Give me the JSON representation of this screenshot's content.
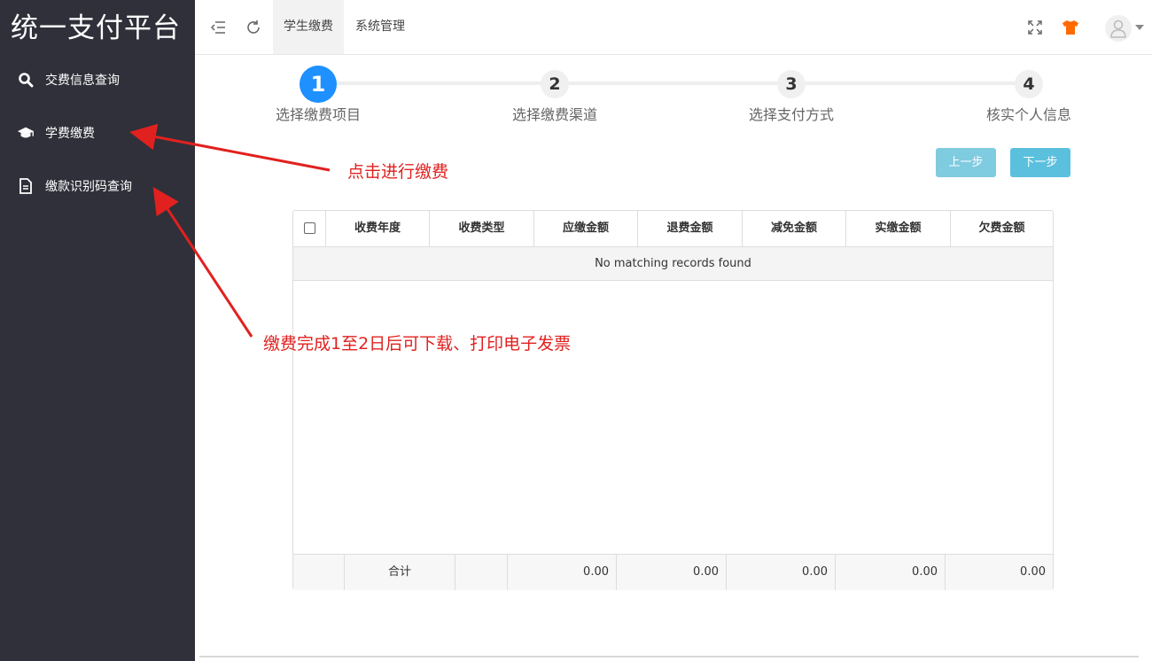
{
  "sidebar": {
    "brand": "统一支付平台",
    "items": [
      {
        "label": "交费信息查询",
        "icon": "search-icon"
      },
      {
        "label": "学费缴费",
        "icon": "graduation-cap-icon"
      },
      {
        "label": "缴款识别码查询",
        "icon": "document-icon"
      }
    ]
  },
  "topbar": {
    "tabs": [
      {
        "label": "学生缴费",
        "active": true
      },
      {
        "label": "系统管理",
        "active": false
      }
    ],
    "icons": [
      "menu-collapse-icon",
      "refresh-icon",
      "fullscreen-icon",
      "theme-shirt-icon",
      "user-avatar-icon"
    ],
    "accent_color": "#ff6a00"
  },
  "steps": [
    {
      "number": "1",
      "label": "选择缴费项目",
      "active": true
    },
    {
      "number": "2",
      "label": "选择缴费渠道",
      "active": false
    },
    {
      "number": "3",
      "label": "选择支付方式",
      "active": false
    },
    {
      "number": "4",
      "label": "核实个人信息",
      "active": false
    }
  ],
  "buttons": {
    "prev": "上一步",
    "next": "下一步"
  },
  "table": {
    "columns": [
      "收费年度",
      "收费类型",
      "应缴金额",
      "退费金额",
      "减免金额",
      "实缴金额",
      "欠费金额"
    ],
    "empty_message": "No matching records found",
    "footer": {
      "label": "合计",
      "values": [
        "0.00",
        "0.00",
        "0.00",
        "0.00",
        "0.00"
      ]
    }
  },
  "annotations": {
    "click_pay": "点击进行缴费",
    "invoice_note": "缴费完成1至2日后可下载、打印电子发票",
    "color": "#e0211f"
  }
}
